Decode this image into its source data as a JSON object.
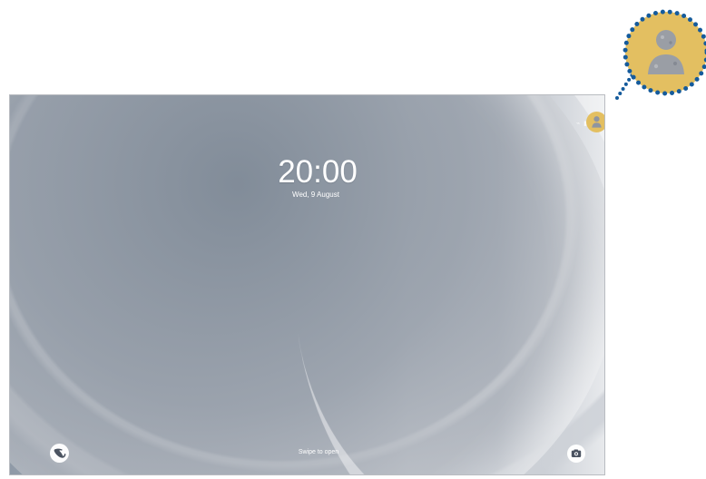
{
  "lock_screen": {
    "time": "20:00",
    "date": "Wed, 9 August",
    "swipe_hint": "Swipe to open",
    "status_text": "",
    "status_icons": [
      "wifi-icon",
      "signal-icon"
    ]
  },
  "icons": {
    "user_profile": "user-profile-icon",
    "left_shortcut": "phone-icon",
    "camera_shortcut": "camera-icon"
  },
  "colors": {
    "profile_button": "#e3bf61",
    "callout_dots": "#155b9c"
  }
}
